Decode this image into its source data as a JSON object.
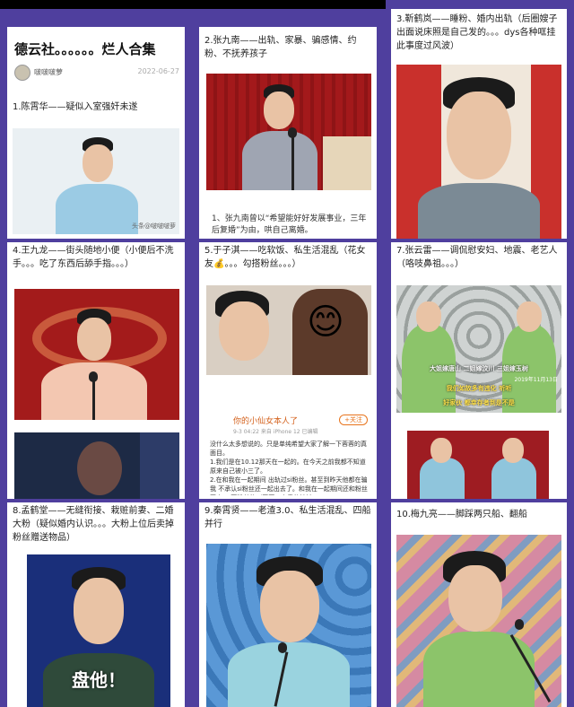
{
  "panels": {
    "p1": {
      "title": "德云社。。。。。。烂人合集",
      "author": "啵啵啵萝",
      "date": "2022-06-27",
      "caption": "1.陈霄华——疑似入室强奸未遂",
      "watermark": "头条@啵啵啵萝"
    },
    "p2": {
      "caption": "2.张九南——出轨、家暴、骗感情、约粉、不抚养孩子",
      "quote": "1、张九南曾以“希望能好好发展事业，三年后复婚”为由，哄自己离婚。"
    },
    "p3": {
      "caption": "3.靳鹤岚——睡粉、婚内出轨（后圈嫂子出面说床照是自己发的。。。dys各种哐挂此事度过风波）"
    },
    "p4": {
      "caption": "4.王九龙——街头随地小便（小便后不洗手。。。吃了东西后舔手指。。。）"
    },
    "p5": {
      "caption": "5.于子淇——吃软饭、私生活混乱（花女友💰。。。勾搭粉丝。。。）",
      "post_title": "你的小仙女本人了",
      "post_meta": "9-3 04:22 来自 iPhone 12 已编辑",
      "follow_label": "+关注",
      "post_text": "没什么太多想说的。只是单纯希望大家了解一下蓉蓉的真面目。\n1.我们是在10.12那天在一起的。在今天之前我都不知道原来自己被小三了。\n2.在和我在一起期间 出轨过si粉丝。甚至到昨天他都在骗我 不承认si粉丝还一起出去了。和我在一起期间还和粉丝开房。 要粉丝的（网页。查看的地址",
      "emoji": "😊"
    },
    "p6": {
      "caption": "7.张云雷——调侃慰安妇、地震、老艺人（咯吱鼻祖。。。）",
      "banner_line1": "大姐嫁唐山 二姐嫁汶川 三姐嫁玉树",
      "banner_line2": "我们如故多有违化 听听",
      "banner_line3": "好家伙 都幸存者到是不是",
      "photo_date": "2019年11月13日"
    },
    "p7": {
      "caption": "8.孟鹤堂——无缝衔接、栽赃前妻、二婚大粉（疑似婚内认识。。。大粉上位后卖掉粉丝赠送物品）",
      "meme_text": "盘他！"
    },
    "p8": {
      "caption": "9.秦霄贤——老渣3.0、私生活混乱、四船并行"
    },
    "p9": {
      "caption": "10.梅九亮——脚踩两只船、翻船"
    }
  },
  "colors": {
    "background": "#4f3f9e",
    "stage_red": "#8f1d1f",
    "robe_blue": "#8fc5dc",
    "robe_green": "#8cc46a"
  }
}
